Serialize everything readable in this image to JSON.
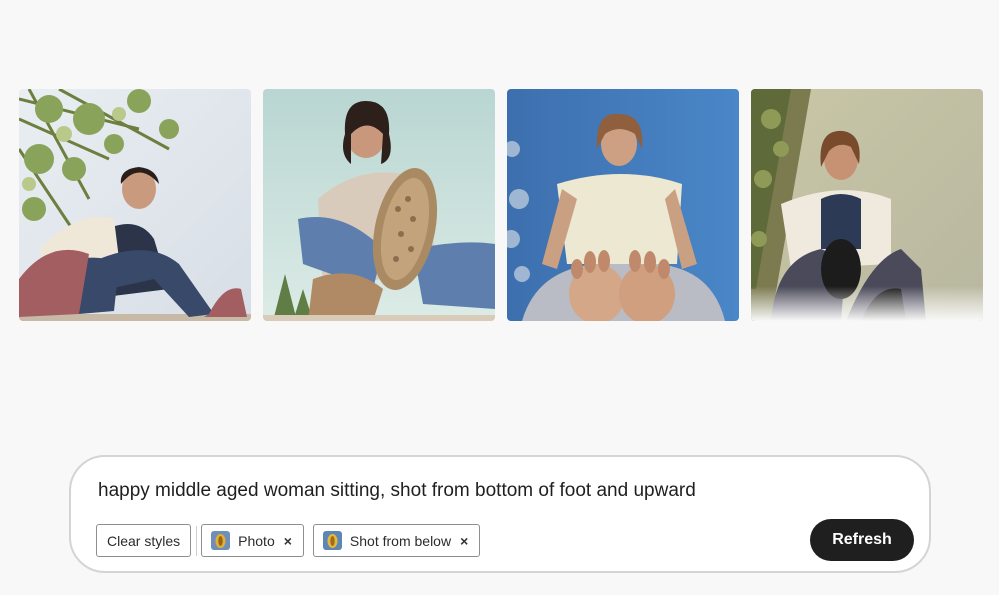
{
  "gallery": {
    "images": [
      {
        "description_icon": "woman-sitting-under-tree-image"
      },
      {
        "description_icon": "woman-foot-sole-closeup-image"
      },
      {
        "description_icon": "woman-blue-sky-feet-image"
      },
      {
        "description_icon": "woman-sitting-sunset-image"
      }
    ]
  },
  "prompt": {
    "text": "happy middle aged woman sitting, shot from bottom of foot and upward"
  },
  "chips": {
    "clear_label": "Clear styles",
    "styles": [
      {
        "label": "Photo",
        "icon": "photo-style-icon"
      },
      {
        "label": "Shot from below",
        "icon": "shot-from-below-style-icon"
      }
    ],
    "remove_glyph": "×"
  },
  "actions": {
    "refresh_label": "Refresh"
  },
  "colors": {
    "page_bg": "#f8f8f8",
    "panel_bg": "#ffffff",
    "button_bg": "#1f1f1f",
    "button_text": "#ffffff"
  }
}
